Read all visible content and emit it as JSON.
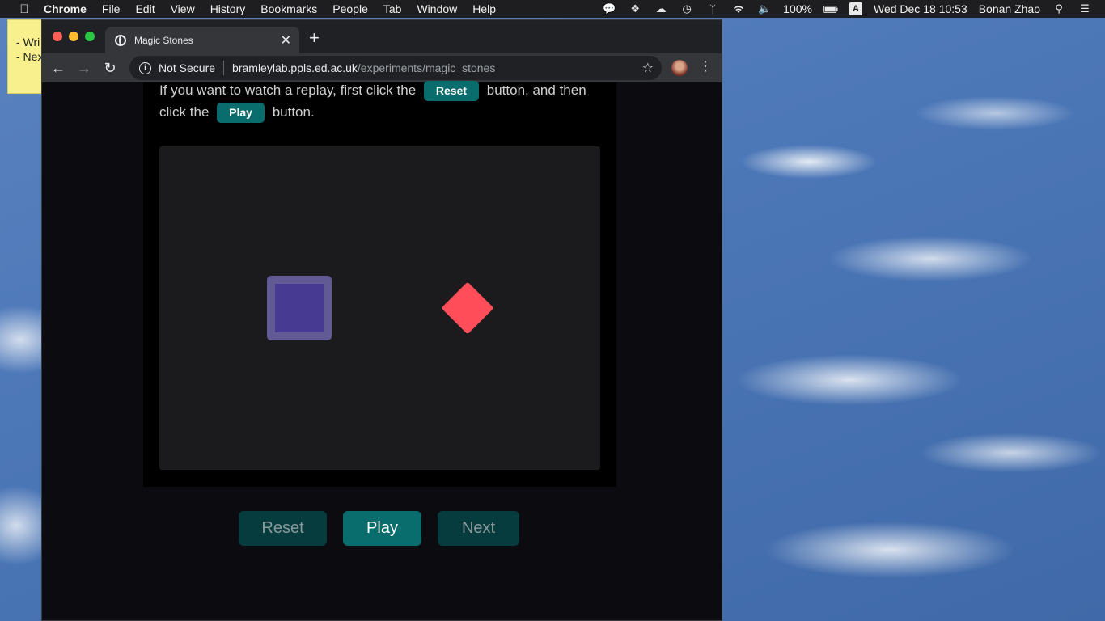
{
  "menubar": {
    "app": "Chrome",
    "menus": [
      "File",
      "Edit",
      "View",
      "History",
      "Bookmarks",
      "People",
      "Tab",
      "Window",
      "Help"
    ],
    "battery": "100%",
    "input_source": "A",
    "datetime": "Wed Dec 18  10:53",
    "user": "Bonan Zhao"
  },
  "sticky_note": {
    "line1": "- Wri",
    "line2": "- Nex"
  },
  "browser": {
    "tab_title": "Magic Stones",
    "security_label": "Not Secure",
    "url_host": "bramleylab.ppls.ed.ac.uk",
    "url_path": "/experiments/magic_stones"
  },
  "page": {
    "instr_part1": "If you want to watch a replay, first click the",
    "instr_reset": "Reset",
    "instr_part2": "button, and then click the",
    "instr_play": "Play",
    "instr_part3": "button.",
    "stones": {
      "agent_color": "#473a92",
      "agent_border_color": "#615a94",
      "recipient_color": "#ff4d5a"
    },
    "controls": {
      "reset_label": "Reset",
      "play_label": "Play",
      "next_label": "Next"
    }
  }
}
